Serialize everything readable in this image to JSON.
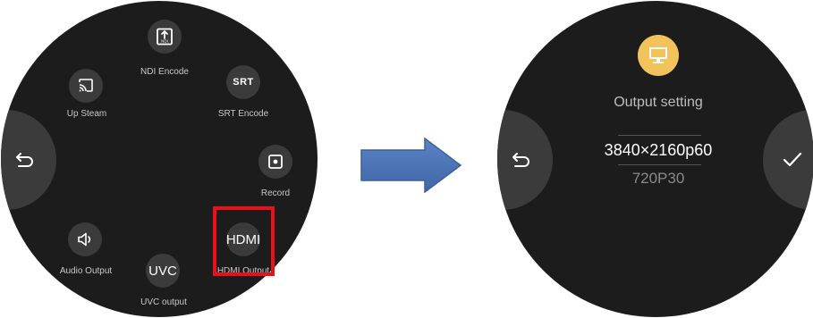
{
  "left_menu": {
    "ndi": {
      "label": "NDI Encode",
      "icon_text": "NDI"
    },
    "srt": {
      "label": "SRT Encode",
      "icon_text": "SRT"
    },
    "upsteam": {
      "label": "Up Steam"
    },
    "record": {
      "label": "Record"
    },
    "hdmi": {
      "label": "HDMI Output",
      "button_text": "HDMI"
    },
    "uvc": {
      "label": "UVC output",
      "button_text": "UVC"
    },
    "audio": {
      "label": "Audio Output"
    },
    "back_icon": "back-arrow-icon",
    "highlight_color": "#e8101a"
  },
  "right_screen": {
    "title": "Output setting",
    "selected_resolution": "3840×2160p60",
    "next_resolution": "720P30",
    "icon": "monitor-icon",
    "icon_bg": "#f2c35a",
    "confirm_icon": "checkmark-icon",
    "back_icon": "back-arrow-icon"
  },
  "arrow_color": "#4a72b2"
}
